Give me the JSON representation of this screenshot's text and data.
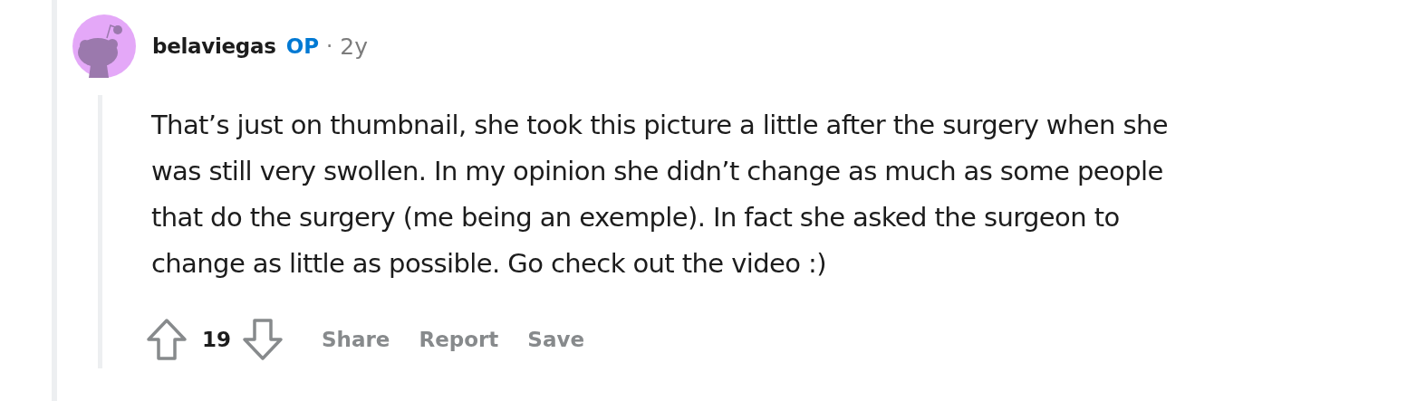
{
  "comment": {
    "author": "belaviegas",
    "op_badge": "OP",
    "separator": "·",
    "age": "2y",
    "body": "That’s just on thumbnail, she took this picture a little after the surgery when she\nwas still very swollen. In my opinion she didn’t change as much as some people\nthat do the surgery (me being an exemple). In fact she asked the surgeon to\nchange as little as possible. Go check out the video :)",
    "score": "19",
    "actions": [
      "Share",
      "Report",
      "Save"
    ]
  }
}
